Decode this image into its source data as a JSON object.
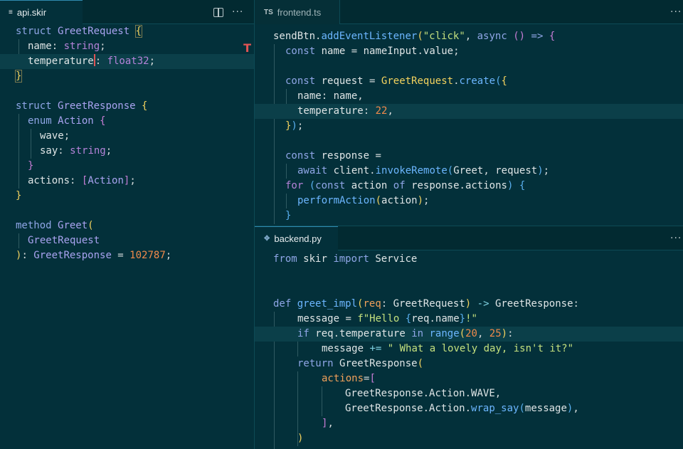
{
  "left_tab": {
    "label": "api.skir",
    "icon": "file-lines-icon"
  },
  "top_tab": {
    "label": "frontend.ts",
    "badge": "TS"
  },
  "bottom_tab": {
    "label": "backend.py",
    "icon": "python-icon"
  },
  "menu_glyph": "···",
  "skir": {
    "kw_struct": "struct",
    "kw_enum": "enum",
    "kw_method": "method",
    "t_req": "GreetRequest",
    "t_res": "GreetResponse",
    "t_action": "Action",
    "t_greet": "Greet",
    "f_name": "name",
    "f_temperature": "temperature",
    "f_wave": "wave",
    "f_say": "say",
    "f_actions": "actions",
    "t_string": "string",
    "t_float32": "float32",
    "method_id": "102787"
  },
  "ts": {
    "sendBtn": "sendBtn",
    "addEventListener": "addEventListener",
    "click": "\"click\"",
    "async": "async",
    "const": "const",
    "name": "name",
    "nameInput": "nameInput",
    "value": "value",
    "request": "request",
    "create": "create",
    "temperature": "temperature",
    "temp_val": "22",
    "response": "response",
    "await": "await",
    "client": "client",
    "invokeRemote": "invokeRemote",
    "for": "for",
    "action": "action",
    "of": "of",
    "actions": "actions",
    "performAction": "performAction"
  },
  "py": {
    "from": "from",
    "skir": "skir",
    "import": "import",
    "Service": "Service",
    "def": "def",
    "greet_impl": "greet_impl",
    "req": "req",
    "message": "message",
    "fstr_a": "f\"Hello ",
    "fstr_b": "!\"",
    "if": "if",
    "in": "in",
    "range": "range",
    "r1": "20",
    "r2": "25",
    "lovely": "\" What a lovely day, isn't it?\"",
    "return": "return",
    "actions_kw": "actions",
    "WAVE": "WAVE",
    "wrap_say": "wrap_say"
  }
}
